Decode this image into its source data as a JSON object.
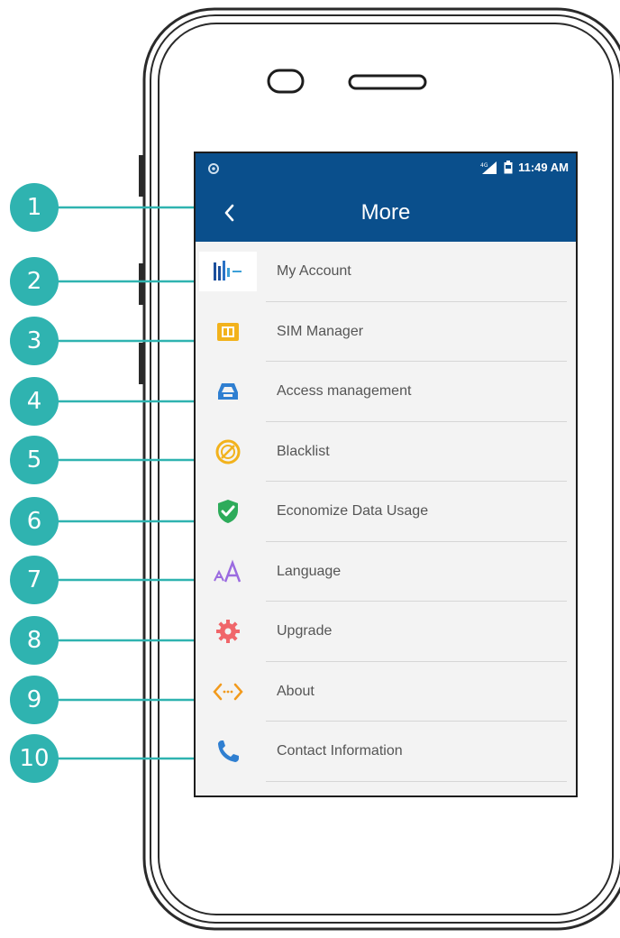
{
  "status_bar": {
    "time": "11:49 AM",
    "left_icon": "notification-icon",
    "right_icons": [
      "signal-icon",
      "battery-icon"
    ]
  },
  "header": {
    "title": "More",
    "back_icon": "chevron-left-icon",
    "background_color": "#0a4f8c"
  },
  "menu": {
    "items": [
      {
        "label": "My Account",
        "icon": "account-logo-icon"
      },
      {
        "label": "SIM Manager",
        "icon": "sim-card-icon"
      },
      {
        "label": "Access management",
        "icon": "access-icon"
      },
      {
        "label": "Blacklist",
        "icon": "blacklist-icon"
      },
      {
        "label": "Economize Data Usage",
        "icon": "shield-check-icon"
      },
      {
        "label": "Language",
        "icon": "font-size-icon"
      },
      {
        "label": "Upgrade",
        "icon": "gear-icon"
      },
      {
        "label": "About",
        "icon": "code-icon"
      },
      {
        "label": "Contact Information",
        "icon": "phone-icon"
      }
    ]
  },
  "callouts": [
    "1",
    "2",
    "3",
    "4",
    "5",
    "6",
    "7",
    "8",
    "9",
    "10"
  ],
  "colors": {
    "callout": "#2fb3b0",
    "header": "#0a4f8c",
    "screen_bg": "#f3f3f3"
  }
}
